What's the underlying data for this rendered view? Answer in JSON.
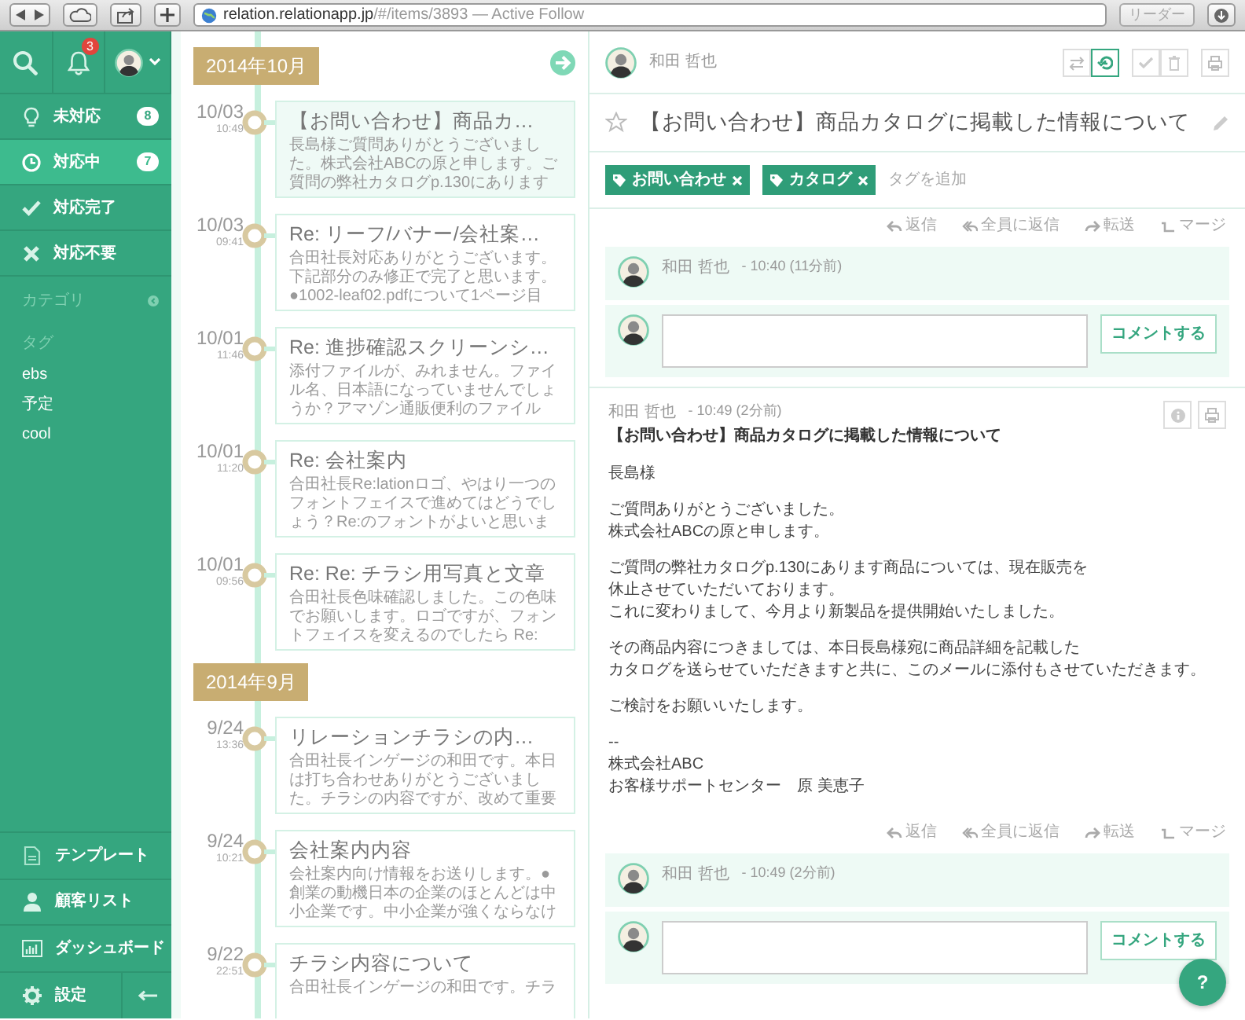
{
  "browser": {
    "address": "**relation.relationapp.jp**/#/items/3893 — Active Follow",
    "reader_button": "リーダー"
  },
  "sidebar": {
    "notification_count": "3",
    "status_items": [
      {
        "label": "未対応",
        "count": "8",
        "selected": false
      },
      {
        "label": "対応中",
        "count": "7",
        "selected": true
      },
      {
        "label": "対応完了",
        "selected": false
      },
      {
        "label": "対応不要",
        "selected": false
      }
    ],
    "category_heading": "カテゴリ",
    "tag_heading": "タグ",
    "tags": [
      "ebs",
      "予定",
      "cool"
    ],
    "bottom_items": [
      "テンプレート",
      "顧客リスト",
      "ダッシュボード",
      "設定"
    ]
  },
  "timeline": {
    "groups": [
      {
        "month": "2014年10月",
        "items": [
          {
            "date": "10/03",
            "time": "10:49",
            "title": "【お問い合わせ】商品カ…",
            "preview": "長島様ご質問ありがとうございました。株式会社ABCの原と申します。ご質問の弊社カタログp.130にあります",
            "selected": true
          },
          {
            "date": "10/03",
            "time": "09:41",
            "title": "Re: リーフ/バナー/会社案…",
            "preview": "合田社長対応ありがとうございます。下記部分のみ修正で完了と思います。●1002-leaf02.pdfについて1ページ目",
            "selected": false
          },
          {
            "date": "10/01",
            "time": "11:46",
            "title": "Re: 進捗確認スクリーンシ…",
            "preview": "添付ファイルが、みれません。ファイル名、日本語になっていませんでしょうか？アマゾン通販便利のファイル",
            "selected": false
          },
          {
            "date": "10/01",
            "time": "11:20",
            "title": "Re: 会社案内",
            "preview": "合田社長Re:lationロゴ、やはり一つのフォントフェイスで進めてはどうでしょう？Re:のフォントがよいと思いま",
            "selected": false
          },
          {
            "date": "10/01",
            "time": "09:56",
            "title": "Re: Re: チラシ用写真と文章",
            "preview": "合田社長色味確認しました。この色味でお願いします。ロゴですが、フォントフェイスを変えるのでしたら Re:",
            "selected": false
          }
        ]
      },
      {
        "month": "2014年9月",
        "items": [
          {
            "date": "9/24",
            "time": "13:36",
            "title": "リレーションチラシの内…",
            "preview": "合田社長インゲージの和田です。本日は打ち合わせありがとうございました。チラシの内容ですが、改めて重要",
            "selected": false
          },
          {
            "date": "9/24",
            "time": "10:21",
            "title": "会社案内内容",
            "preview": "会社案内向け情報をお送りします。●創業の動機日本の企業のほとんどは中小企業です。中小企業が強くならなけ",
            "selected": false
          },
          {
            "date": "9/22",
            "time": "22:51",
            "title": "チラシ内容について",
            "preview": "合田社長インゲージの和田です。チラ",
            "selected": false
          }
        ]
      }
    ]
  },
  "detail": {
    "assignee": "和田 哲也",
    "toolbar": [
      {
        "selected": false
      },
      {
        "selected": true
      },
      {
        "selected": false
      },
      {
        "selected": false
      },
      {
        "selected": false
      }
    ],
    "title": "【お問い合わせ】商品カタログに掲載した情報について",
    "starred": false,
    "tags": [
      "お問い合わせ",
      "カタログ"
    ],
    "add_tag_placeholder": "タグを追加",
    "thread": [
      {
        "kind": "actions",
        "items": [
          "返信",
          "全員に返信",
          "転送",
          "マージ"
        ]
      },
      {
        "kind": "comment",
        "author": "和田 哲也",
        "time": "- 10:40 (11分前)"
      },
      {
        "kind": "comment_form",
        "button": "コメントする"
      },
      {
        "kind": "email",
        "author": "和田 哲也",
        "time": "- 10:49 (2分前)",
        "subject": "【お問い合わせ】商品カタログに掲載した情報について",
        "body": [
          [
            "長島様"
          ],
          [
            "ご質問ありがとうございました。",
            "株式会社ABCの原と申します。"
          ],
          [
            "ご質問の弊社カタログp.130にあります商品については、現在販売を",
            "休止させていただいております。",
            "これに変わりまして、今月より新製品を提供開始いたしました。"
          ],
          [
            "その商品内容につきましては、本日長島様宛に商品詳細を記載した",
            "カタログを送らせていただきますと共に、このメールに添付もさせていただきます。"
          ],
          [
            "ご検討をお願いいたします。"
          ],
          [
            "--",
            "株式会社ABC",
            "お客様サポートセンター　原 美恵子"
          ]
        ]
      },
      {
        "kind": "actions",
        "items": [
          "返信",
          "全員に返信",
          "転送",
          "マージ"
        ]
      },
      {
        "kind": "comment",
        "author": "和田 哲也",
        "time": "- 10:49 (2分前)"
      },
      {
        "kind": "comment_form",
        "button": "コメントする"
      }
    ]
  },
  "help_button": "?"
}
